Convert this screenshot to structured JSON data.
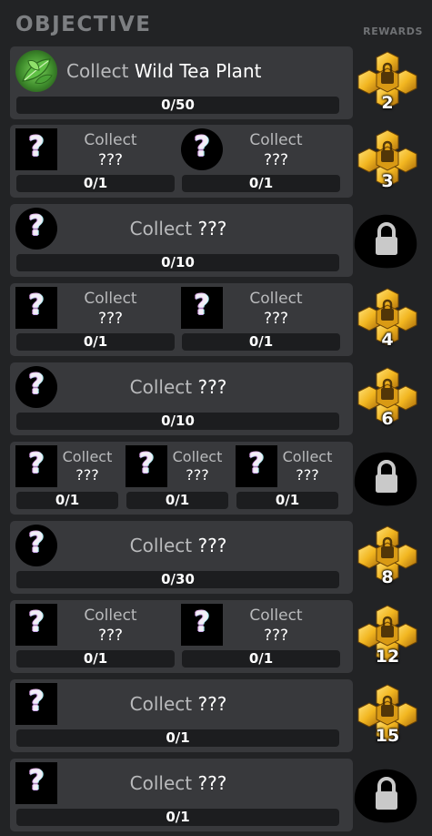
{
  "header": {
    "title": "OBJECTIVE",
    "rewards_label": "REWARDS"
  },
  "colors": {
    "row_bg": "#38393c",
    "bar_bg": "#1c1d1f",
    "gold": "#f2b620",
    "locked": "#000000"
  },
  "objectives": [
    {
      "layout": "single",
      "items": [
        {
          "icon": "tea-leaf-icon",
          "shape": "round",
          "verb": "Collect",
          "name": "Wild Tea Plant",
          "progress": "0/50"
        }
      ],
      "reward": {
        "type": "gold",
        "count": "2"
      }
    },
    {
      "layout": "double",
      "items": [
        {
          "icon": "unknown-item-icon",
          "shape": "square",
          "verb": "Collect",
          "name": "???",
          "progress": "0/1"
        },
        {
          "icon": "unknown-item-icon",
          "shape": "round",
          "verb": "Collect",
          "name": "???",
          "progress": "0/1"
        }
      ],
      "reward": {
        "type": "gold",
        "count": "3"
      }
    },
    {
      "layout": "single",
      "items": [
        {
          "icon": "unknown-item-icon",
          "shape": "round",
          "verb": "Collect",
          "name": "???",
          "progress": "0/10"
        }
      ],
      "reward": {
        "type": "locked",
        "count": ""
      }
    },
    {
      "layout": "double",
      "items": [
        {
          "icon": "unknown-item-icon",
          "shape": "square",
          "verb": "Collect",
          "name": "???",
          "progress": "0/1"
        },
        {
          "icon": "unknown-item-icon",
          "shape": "square",
          "verb": "Collect",
          "name": "???",
          "progress": "0/1"
        }
      ],
      "reward": {
        "type": "gold",
        "count": "4"
      }
    },
    {
      "layout": "single",
      "items": [
        {
          "icon": "unknown-item-icon",
          "shape": "round",
          "verb": "Collect",
          "name": "???",
          "progress": "0/10"
        }
      ],
      "reward": {
        "type": "gold",
        "count": "6"
      }
    },
    {
      "layout": "triple",
      "items": [
        {
          "icon": "unknown-item-icon",
          "shape": "square",
          "verb": "Collect",
          "name": "???",
          "progress": "0/1"
        },
        {
          "icon": "unknown-item-icon",
          "shape": "square",
          "verb": "Collect",
          "name": "???",
          "progress": "0/1"
        },
        {
          "icon": "unknown-item-icon",
          "shape": "square",
          "verb": "Collect",
          "name": "???",
          "progress": "0/1"
        }
      ],
      "reward": {
        "type": "locked",
        "count": ""
      }
    },
    {
      "layout": "single",
      "items": [
        {
          "icon": "unknown-item-icon",
          "shape": "round",
          "verb": "Collect",
          "name": "???",
          "progress": "0/30"
        }
      ],
      "reward": {
        "type": "gold",
        "count": "8"
      }
    },
    {
      "layout": "double",
      "items": [
        {
          "icon": "unknown-item-icon",
          "shape": "square",
          "verb": "Collect",
          "name": "???",
          "progress": "0/1"
        },
        {
          "icon": "unknown-item-icon",
          "shape": "square",
          "verb": "Collect",
          "name": "???",
          "progress": "0/1"
        }
      ],
      "reward": {
        "type": "gold",
        "count": "12"
      }
    },
    {
      "layout": "single",
      "items": [
        {
          "icon": "unknown-item-icon",
          "shape": "square",
          "verb": "Collect",
          "name": "???",
          "progress": "0/1"
        }
      ],
      "reward": {
        "type": "gold",
        "count": "15"
      }
    },
    {
      "layout": "single",
      "items": [
        {
          "icon": "unknown-item-icon",
          "shape": "square",
          "verb": "Collect",
          "name": "???",
          "progress": "0/1"
        }
      ],
      "reward": {
        "type": "locked",
        "count": ""
      }
    }
  ]
}
